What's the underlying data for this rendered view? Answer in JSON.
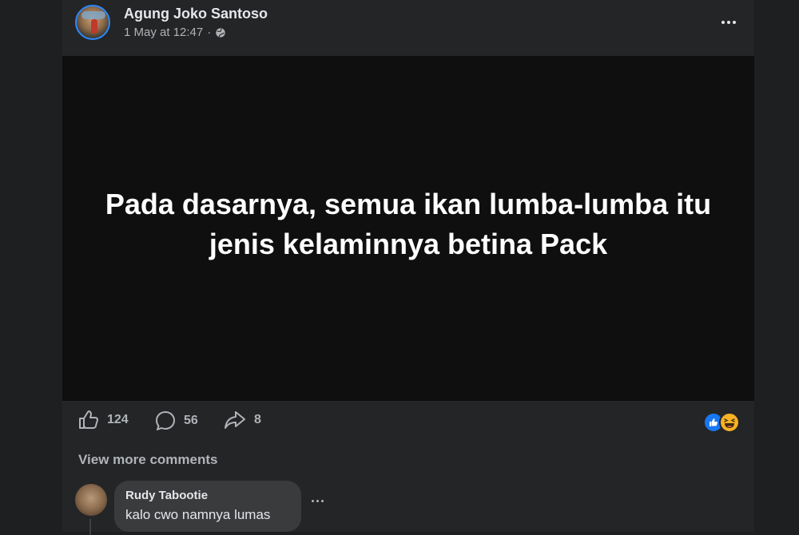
{
  "post": {
    "author": "Agung Joko Santoso",
    "timestamp": "1 May at 12:47",
    "separator": "·",
    "privacy_icon": "globe-icon",
    "text": "Pada dasarnya, semua ikan lumba-lumba itu jenis kelaminnya betina Pack",
    "background_color": "#0f0f10"
  },
  "actions": {
    "likes": "124",
    "comments": "56",
    "shares": "8",
    "reactions": [
      "like",
      "haha"
    ]
  },
  "comments": {
    "view_more_label": "View more comments",
    "items": [
      {
        "name": "Rudy Tabootie",
        "text": "kalo cwo namnya lumas"
      }
    ]
  },
  "colors": {
    "accent": "#1877f2",
    "card": "#242526",
    "bubble": "#3a3b3c"
  }
}
